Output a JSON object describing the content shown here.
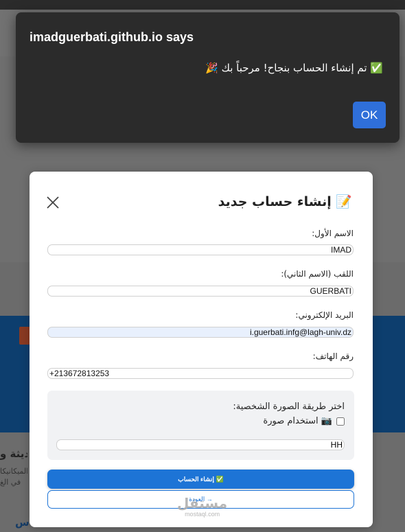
{
  "alert": {
    "origin": "imadguerbati.github.io says",
    "message": "✅ تم إنشاء الحساب بنجاح! مرحباً بك 🎉",
    "ok_label": "OK"
  },
  "background": {
    "heading_fragment": "حديثة و",
    "text_fragment_1": "ع الميكانيكا",
    "text_fragment_2": "في الغ",
    "blue_fragment": "س"
  },
  "modal": {
    "title": "📝 إنشاء حساب جديد",
    "close_icon": "close-icon",
    "fields": {
      "first_name": {
        "label": "الاسم الأول:",
        "value": "IMAD"
      },
      "last_name": {
        "label": "اللقب (الاسم الثاني):",
        "value": "GUERBATI"
      },
      "email": {
        "label": "البريد الإلكتروني:",
        "value": "i.guerbati.infg@lagh-univ.dz"
      },
      "phone": {
        "label": "رقم الهاتف:",
        "value": "+213672813253"
      }
    },
    "photo": {
      "title": "اختر طريقة الصورة الشخصية:",
      "option_label": "📷 استخدام صورة",
      "option_checked": false,
      "input_value": "HH"
    },
    "create_label": "✅ إنشاء الحساب",
    "back_label": "→ العودة"
  },
  "watermark": {
    "arabic": "مستقل",
    "latin": "mostaql.com"
  },
  "colors": {
    "primary": "#1d74d6",
    "alert_bg": "#2b2b2b",
    "ok_button": "#2f6fd9",
    "autofill": "#e8f0fd"
  }
}
